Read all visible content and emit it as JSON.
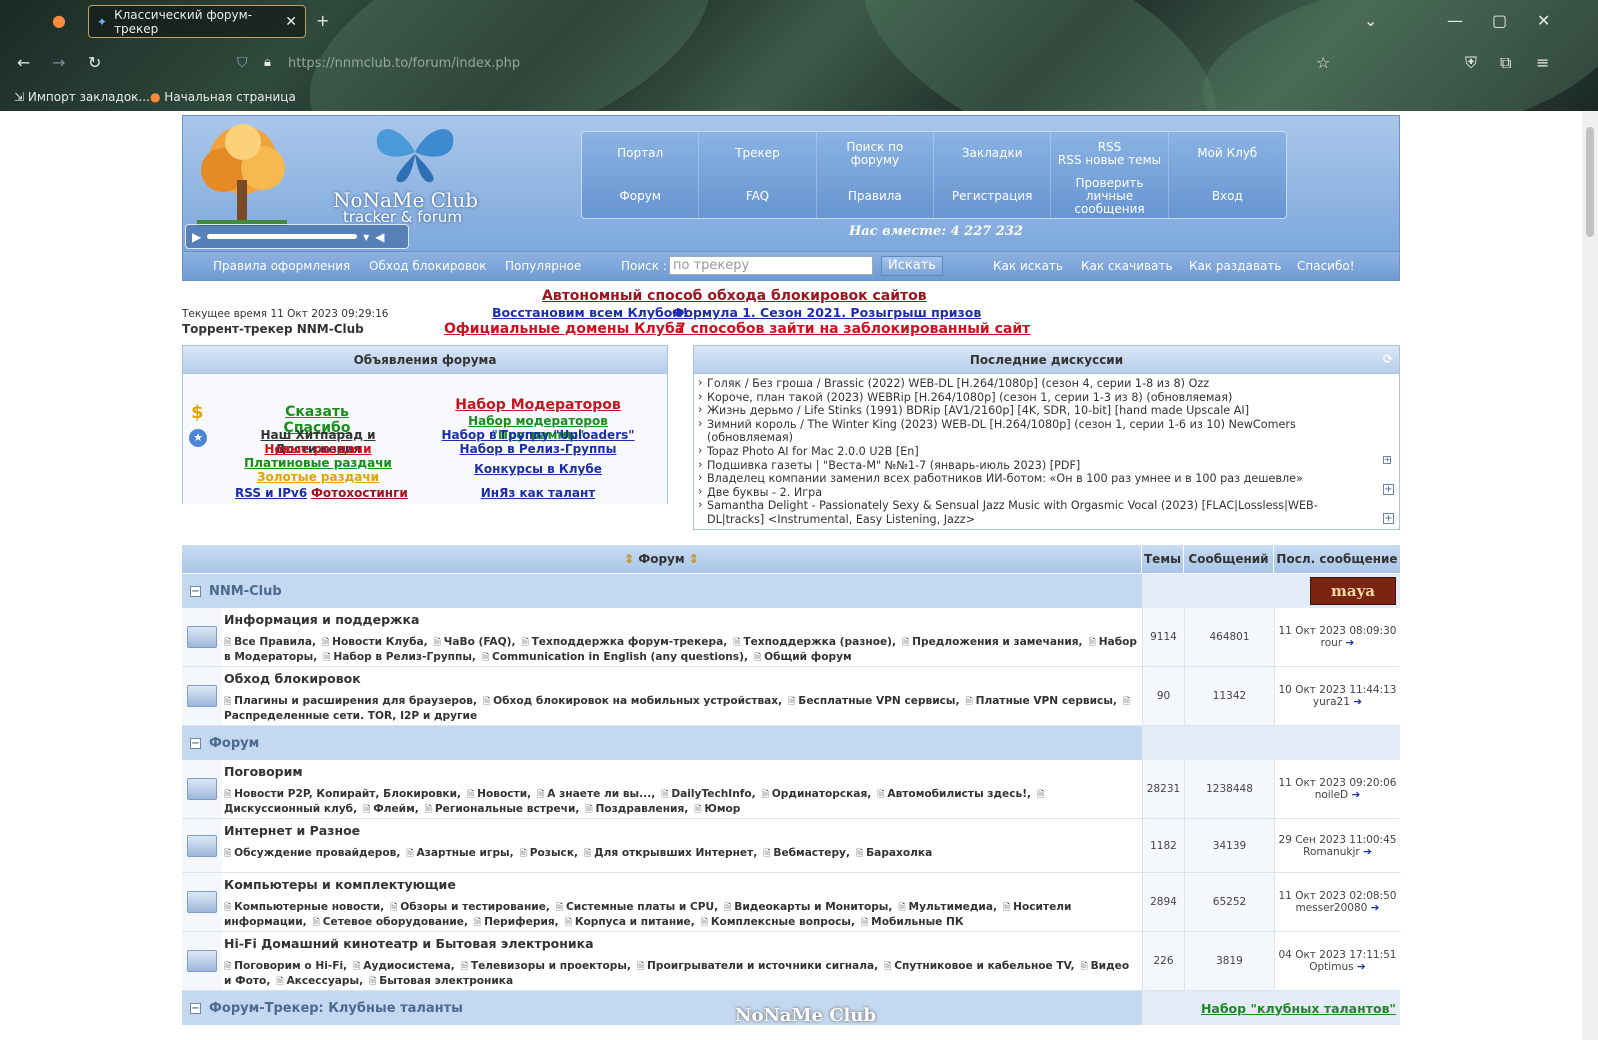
{
  "browser": {
    "tab_title": "Классический форум-трекер",
    "url": "https://nnmclub.to/forum/index.php",
    "bookmarks": [
      "Импорт закладок...",
      "Начальная страница"
    ]
  },
  "header": {
    "logo_title": "NoNaMe Club",
    "logo_sub": "tracker & forum",
    "together": "Нас вместе: 4 227 232",
    "nav_top": [
      "Портал",
      "Трекер",
      "Поиск по форуму",
      "Закладки",
      "RSS\nRSS новые темы",
      "Мой Клуб"
    ],
    "nav_bottom": [
      "Форум",
      "FAQ",
      "Правила",
      "Регистрация",
      "Проверить личные сообщения",
      "Вход"
    ]
  },
  "subnav": {
    "links_left": [
      "Правила оформления",
      "Обход блокировок",
      "Популярное"
    ],
    "search_label": "Поиск :",
    "search_placeholder": "по трекеру",
    "search_button": "Искать",
    "links_right": [
      "Как искать",
      "Как скачивать",
      "Как раздавать",
      "Спасибо!"
    ]
  },
  "announce": {
    "time": "Текущее время 11 Окт 2023 09:29:16",
    "site": "Торрент-трекер NNM-Club",
    "line1": "Автономный способ обхода блокировок сайтов",
    "line2a": "Восстановим всем Клубом!",
    "line2b": "Формула 1. Сезон 2021. Розыгрыш призов",
    "line3a": "Официальные домены Клуба",
    "line3b": "7 способов зайти на заблокированный сайт"
  },
  "forum_ann": {
    "title": "Объявления форума",
    "left": [
      "Сказать Спасибо",
      "Наш Хитпарад и Достижения",
      "Новые раздачи",
      "Платиновые раздачи",
      "Золотые раздачи"
    ],
    "rss": "RSS и IPv6",
    "photo": "Фотохостинги",
    "right": [
      "Набор Модераторов",
      "Набор модераторов \"Программы\"",
      "Набор в Группу \"Uploaders\"",
      "Набор в Релиз-Группы",
      "Конкурсы в Клубе",
      "ИнЯз как талант"
    ]
  },
  "discussions": {
    "title": "Последние дискуссии",
    "items": [
      "Голяк / Без гроша / Brassic (2022) WEB-DL [H.264/1080p] (сезон 4, серии 1-8 из 8) Ozz",
      "Короче, план такой (2023) WEBRip [H.264/1080p] (сезон 1, серии 1-3 из 8) (обновляемая)",
      "Жизнь дерьмо / Life Stinks (1991) BDRip [AV1/2160p] [4K, SDR, 10-bit] [hand made Upscale AI]",
      "Зимний король / The Winter King (2023) WEB-DL [H.264/1080p] (сезон 1, серии 1-6 из 10) NewComers (обновляемая)",
      "Topaz Photo AI for Mac 2.0.0 U2B [En]",
      "Подшивка газеты | \"Веста-М\" №№1-7 (январь-июль 2023) [PDF]",
      "Владелец компании заменил всех работников ИИ-ботом: «Он в 100 раз умнее и в 100 раз дешевле»",
      "Две буквы - 2. Игра",
      "Samantha Delight - Passionately Sexy & Sensual Jazz Music with Orgasmic Vocal (2023) [FLAC|Lossless|WEB-DL|tracks] <Instrumental, Easy Listening, Jazz>"
    ]
  },
  "table": {
    "col_forum": "Форум",
    "col_topics": "Темы",
    "col_posts": "Сообщений",
    "col_last": "Посл. сообщение",
    "cat1": "NNM-Club",
    "cat1_badge": "maya",
    "rows1": [
      {
        "title": "Информация и поддержка",
        "subs": [
          "Все Правила,",
          "Новости Клуба,",
          "ЧаВо (FAQ),",
          "Техподдержка форум-трекера,",
          "Техподдержка (разное),",
          "Предложения и замечания,",
          "Набор в Модераторы,",
          "Набор в Релиз-Группы,",
          "Communication in English (any questions),",
          "Общий форум"
        ],
        "topics": "9114",
        "posts": "464801",
        "date": "11 Окт 2023 08:09:30",
        "user": "rour"
      },
      {
        "title": "Обход блокировок",
        "subs": [
          "Плагины и расширения для браузеров,",
          "Обход блокировок на мобильных устройствах,",
          "Бесплатные VPN сервисы,",
          "Платные VPN сервисы,",
          "Распределенные сети. TOR, I2P и другие"
        ],
        "topics": "90",
        "posts": "11342",
        "date": "10 Окт 2023 11:44:13",
        "user": "yura21"
      }
    ],
    "cat2": "Форум",
    "rows2": [
      {
        "title": "Поговорим",
        "subs": [
          "Новости P2P, Копирайт, Блокировки,",
          "Новости,",
          "А знаете ли вы...,",
          "DailyTechInfo,",
          "Ординаторская,",
          "Автомобилисты здесь!,",
          "Дискуссионный клуб,",
          "Флейм,",
          "Региональные встречи,",
          "Поздравления,",
          "Юмор"
        ],
        "topics": "28231",
        "posts": "1238448",
        "date": "11 Окт 2023 09:20:06",
        "user": "noileD"
      },
      {
        "title": "Интернет и Разное",
        "subs": [
          "Обсуждение провайдеров,",
          "Азартные игры,",
          "Розыск,",
          "Для открывших Интернет,",
          "Вебмастеру,",
          "Барахолка"
        ],
        "topics": "1182",
        "posts": "34139",
        "date": "29 Сен 2023 11:00:45",
        "user": "Romanukjr"
      },
      {
        "title": "Компьютеры и комплектующие",
        "subs": [
          "Компьютерные новости,",
          "Обзоры и тестирование,",
          "Системные платы и CPU,",
          "Видеокарты и Мониторы,",
          "Мультимедиа,",
          "Носители информации,",
          "Сетевое оборудование,",
          "Периферия,",
          "Корпуса и питание,",
          "Комплексные вопросы,",
          "Мобильные ПК"
        ],
        "topics": "2894",
        "posts": "65252",
        "date": "11 Окт 2023 02:08:50",
        "user": "messer20080"
      },
      {
        "title": "Hi-Fi Домашний кинотеатр и Бытовая электроника",
        "subs": [
          "Поговорим о Hi-Fi,",
          "Аудиосистема,",
          "Телевизоры и проекторы,",
          "Проигрыватели и источники сигнала,",
          "Спутниковое и кабельное TV,",
          "Видео и Фото,",
          "Аксессуары,",
          "Бытовая электроника"
        ],
        "topics": "226",
        "posts": "3819",
        "date": "04 Окт 2023 17:11:51",
        "user": "Optimus"
      }
    ],
    "cat3": "Форум-Трекер: Клубные таланты",
    "cat3_link": "Набор \"клубных талантов\""
  },
  "watermark": "NoNaMe Club"
}
